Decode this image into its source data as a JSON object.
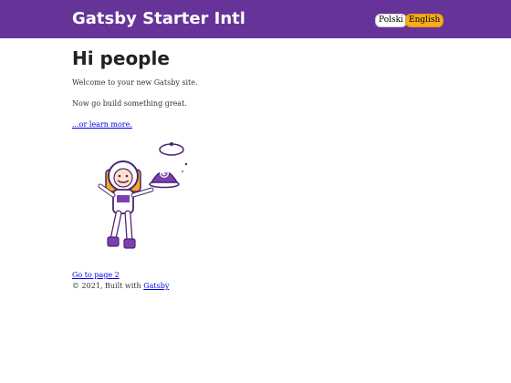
{
  "header": {
    "title": "Gatsby Starter Intl",
    "languages": [
      {
        "label": "Polski"
      },
      {
        "label": "English"
      }
    ],
    "colors": {
      "bar": "#663399",
      "active_language": "#f6ac1b"
    }
  },
  "main": {
    "heading": "Hi people",
    "paragraphs": [
      "Welcome to your new Gatsby site.",
      "Now go build something great."
    ],
    "learn_more_link": "...or learn more.",
    "image": {
      "icon": "gatsby-astronaut-illustration"
    },
    "page2_link": "Go to page 2"
  },
  "footer": {
    "prefix": "© 2021, Built with",
    "link": "Gatsby"
  }
}
